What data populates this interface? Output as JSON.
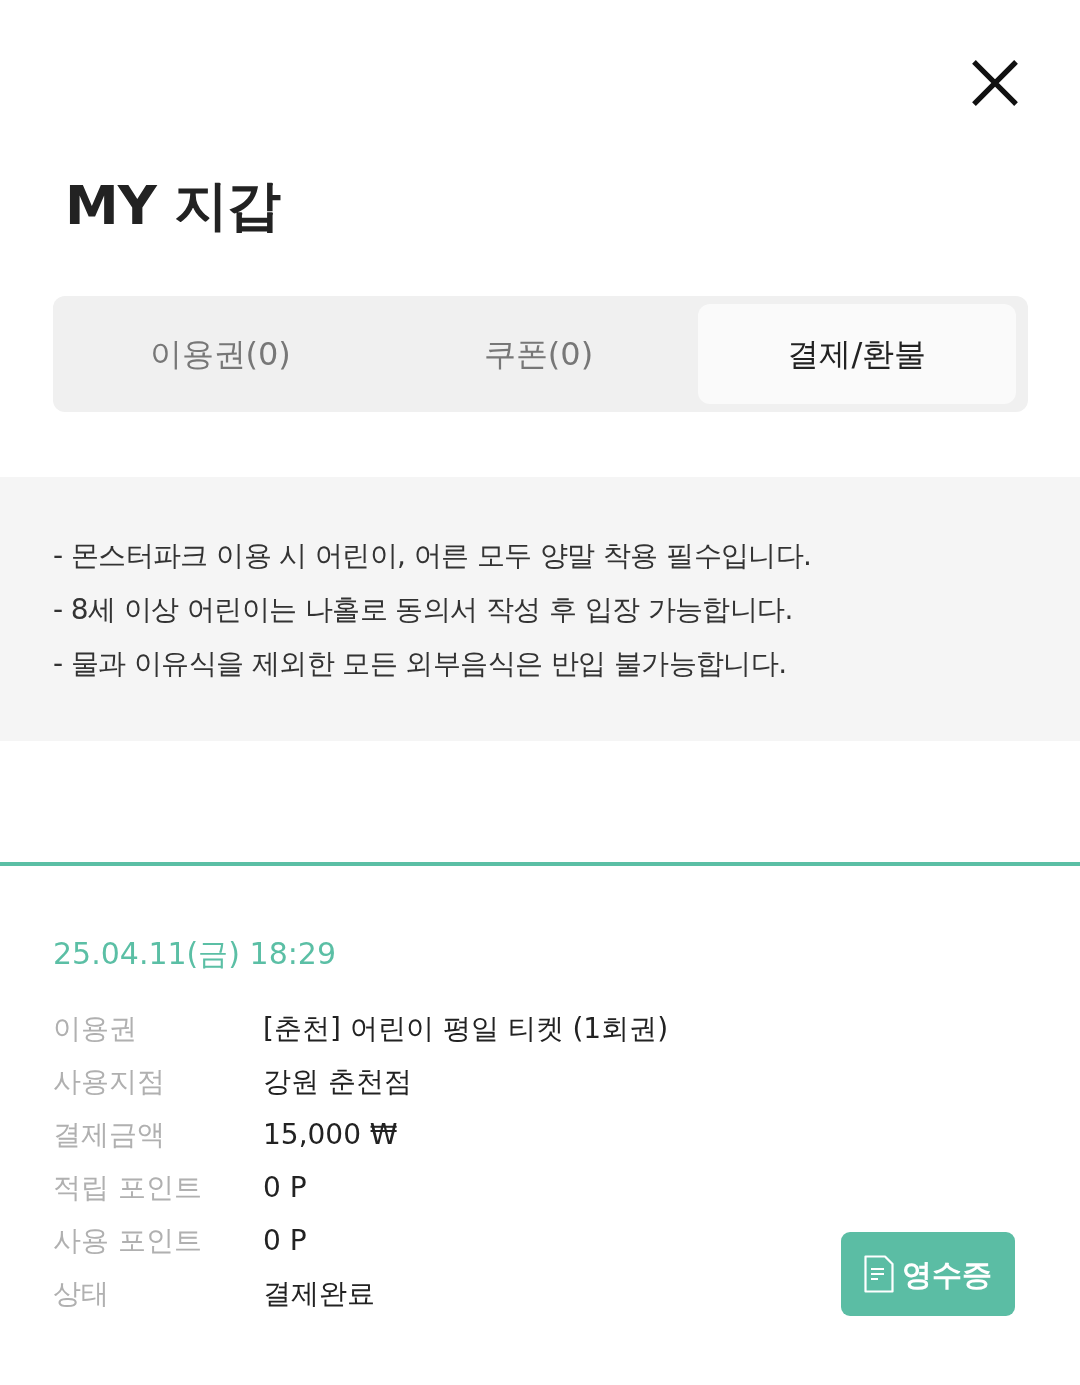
{
  "header": {
    "title": "MY 지갑"
  },
  "tabs": [
    {
      "label": "이용권(0)",
      "selected": false
    },
    {
      "label": "쿠폰(0)",
      "selected": false
    },
    {
      "label": "결제/환불",
      "selected": true
    }
  ],
  "notices": [
    "- 몬스터파크 이용 시 어린이, 어른 모두 양말 착용 필수입니다.",
    "- 8세 이상 어린이는 나홀로 동의서 작성 후 입장 가능합니다.",
    "- 물과 이유식을 제외한 모든 외부음식은 반입 불가능합니다."
  ],
  "payments": [
    {
      "datetime": "25.04.11(금) 18:29",
      "details": [
        {
          "label": "이용권",
          "value": "[춘천] 어린이 평일 티켓 (1회권)"
        },
        {
          "label": "사용지점",
          "value": "강원 춘천점"
        },
        {
          "label": "결제금액",
          "value": "15,000 ₩"
        },
        {
          "label": "적립 포인트",
          "value": "0 P"
        },
        {
          "label": "사용 포인트",
          "value": "0 P"
        },
        {
          "label": "상태",
          "value": "결제완료"
        }
      ],
      "receipt_button": "영수증"
    }
  ]
}
